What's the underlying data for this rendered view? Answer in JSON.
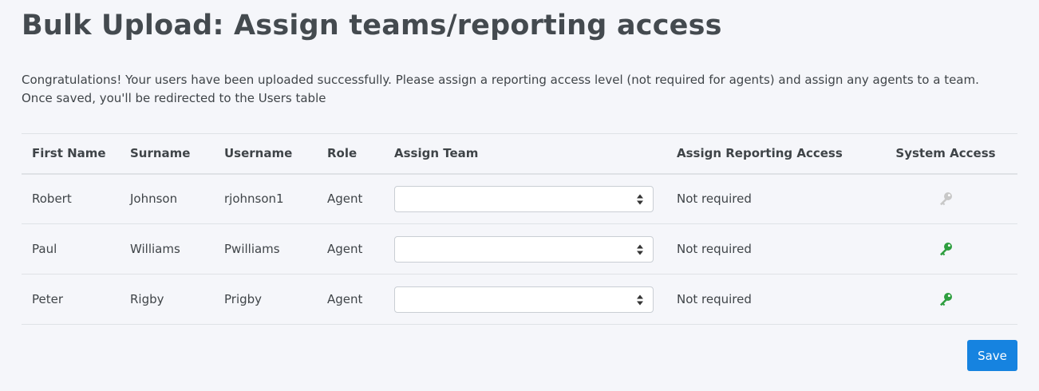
{
  "page": {
    "title": "Bulk Upload: Assign teams/reporting access",
    "intro": "Congratulations! Your users have been uploaded successfully. Please assign a reporting access level (not required for agents) and assign any agents to a team. Once saved, you'll be redirected to the Users table"
  },
  "table": {
    "columns": {
      "first_name": "First Name",
      "surname": "Surname",
      "username": "Username",
      "role": "Role",
      "assign_team": "Assign Team",
      "assign_reporting_access": "Assign Reporting Access",
      "system_access": "System Access"
    },
    "rows": [
      {
        "first_name": "Robert",
        "surname": "Johnson",
        "username": "rjohnson1",
        "role": "Agent",
        "team": "",
        "reporting_access": "Not required",
        "system_access_icon": "key-icon",
        "system_access_enabled": false
      },
      {
        "first_name": "Paul",
        "surname": "Williams",
        "username": "Pwilliams",
        "role": "Agent",
        "team": "",
        "reporting_access": "Not required",
        "system_access_icon": "key-icon",
        "system_access_enabled": true
      },
      {
        "first_name": "Peter",
        "surname": "Rigby",
        "username": "Prigby",
        "role": "Agent",
        "team": "",
        "reporting_access": "Not required",
        "system_access_icon": "key-icon",
        "system_access_enabled": true
      }
    ]
  },
  "actions": {
    "save_label": "Save"
  },
  "colors": {
    "key_enabled": "#2e9e3f",
    "key_disabled": "#c8c8c8",
    "primary": "#1683e0"
  }
}
